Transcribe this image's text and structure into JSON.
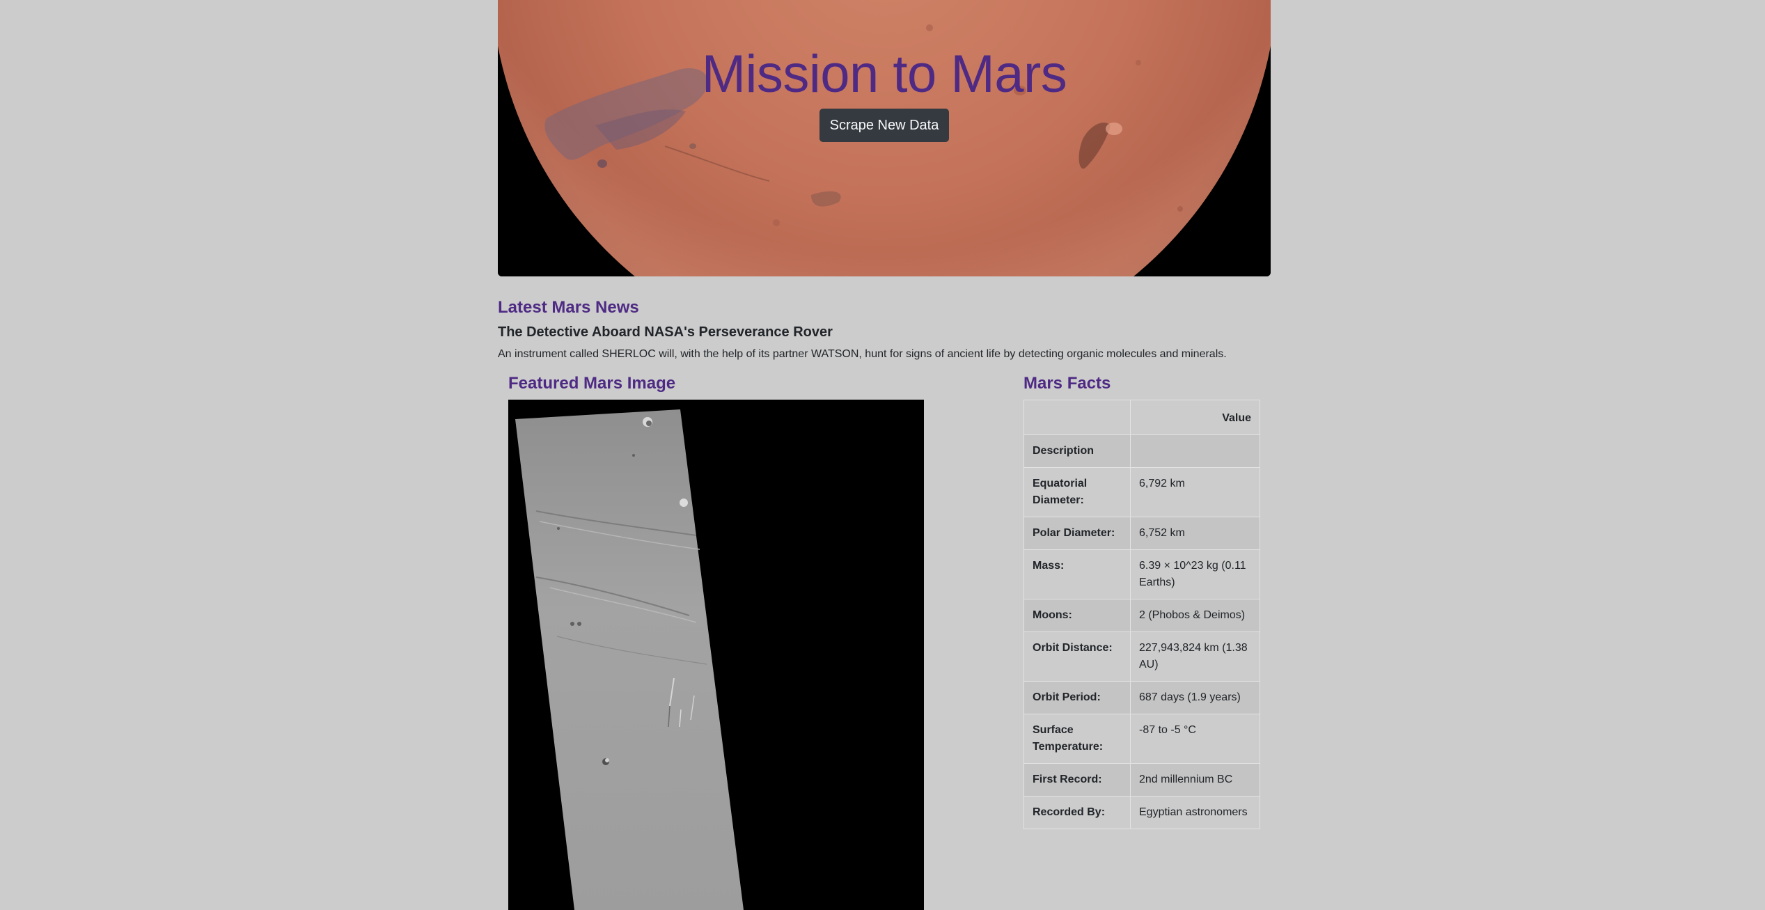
{
  "hero": {
    "title": "Mission to Mars",
    "scrape_button": "Scrape New Data"
  },
  "news": {
    "heading": "Latest Mars News",
    "title": "The Detective Aboard NASA's Perseverance Rover",
    "teaser": "An instrument called SHERLOC will, with the help of its partner WATSON, hunt for signs of ancient life by detecting organic molecules and minerals."
  },
  "featured": {
    "heading": "Featured Mars Image"
  },
  "facts": {
    "heading": "Mars Facts",
    "header_col1": "",
    "header_col2": "Value",
    "rows": [
      {
        "label": "Description",
        "value": ""
      },
      {
        "label": "Equatorial Diameter:",
        "value": "6,792 km"
      },
      {
        "label": "Polar Diameter:",
        "value": "6,752 km"
      },
      {
        "label": "Mass:",
        "value": "6.39 × 10^23 kg (0.11 Earths)"
      },
      {
        "label": "Moons:",
        "value": "2 (Phobos & Deimos)"
      },
      {
        "label": "Orbit Distance:",
        "value": "227,943,824 km (1.38 AU)"
      },
      {
        "label": "Orbit Period:",
        "value": "687 days (1.9 years)"
      },
      {
        "label": "Surface Temperature:",
        "value": "-87 to -5 °C"
      },
      {
        "label": "First Record:",
        "value": "2nd millennium BC"
      },
      {
        "label": "Recorded By:",
        "value": "Egyptian astronomers"
      }
    ]
  },
  "colors": {
    "heading_purple": "#4e2a84",
    "page_bg": "#cccccc",
    "button_dark": "#343a40",
    "mars_surface": "#c8735a"
  }
}
